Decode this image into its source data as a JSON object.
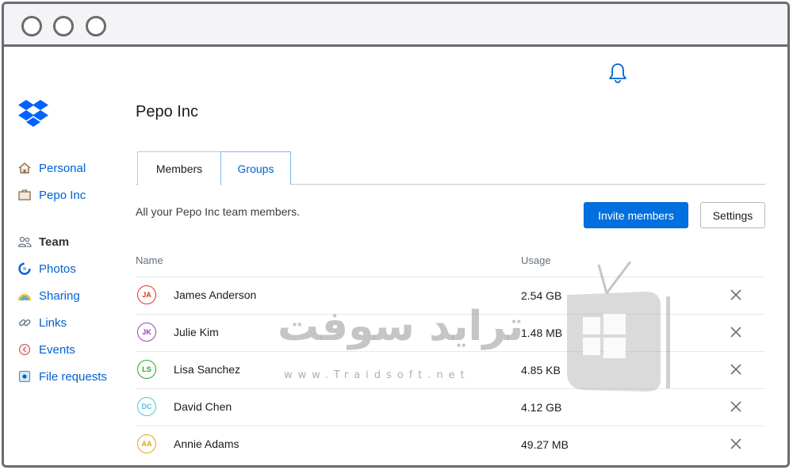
{
  "colors": {
    "accent": "#0061d5",
    "primary_button": "#0070e0",
    "frame": "#6b6b70"
  },
  "header": {
    "notifications_icon": "bell-icon"
  },
  "sidebar": {
    "logo_icon": "dropbox-logo-icon",
    "items": [
      {
        "label": "Personal",
        "icon": "home-icon"
      },
      {
        "label": "Pepo Inc",
        "icon": "briefcase-icon"
      },
      {
        "label": "Team",
        "icon": "team-icon"
      },
      {
        "label": "Photos",
        "icon": "photos-icon"
      },
      {
        "label": "Sharing",
        "icon": "sharing-icon"
      },
      {
        "label": "Links",
        "icon": "link-icon"
      },
      {
        "label": "Events",
        "icon": "events-icon"
      },
      {
        "label": "File requests",
        "icon": "file-request-icon"
      }
    ]
  },
  "main": {
    "title": "Pepo Inc",
    "tabs": [
      {
        "label": "Members"
      },
      {
        "label": "Groups"
      }
    ],
    "description": "All your Pepo Inc team members.",
    "invite_button": "Invite members",
    "settings_button": "Settings",
    "table": {
      "columns": [
        "Name",
        "Usage"
      ],
      "rows": [
        {
          "initials": "JA",
          "name": "James Anderson",
          "usage": "2.54 GB",
          "color": "#e0361f"
        },
        {
          "initials": "JK",
          "name": "Julie Kim",
          "usage": "1.48 MB",
          "color": "#9b3fc4"
        },
        {
          "initials": "LS",
          "name": "Lisa Sanchez",
          "usage": "4.85 KB",
          "color": "#2aa52a"
        },
        {
          "initials": "DC",
          "name": "David Chen",
          "usage": "4.12 GB",
          "color": "#4cc3db"
        },
        {
          "initials": "AA",
          "name": "Annie Adams",
          "usage": "49.27 MB",
          "color": "#e3a21a"
        }
      ]
    }
  },
  "watermark": {
    "text": "ترايد سوفت",
    "url": "www.Traidsoft.net"
  }
}
